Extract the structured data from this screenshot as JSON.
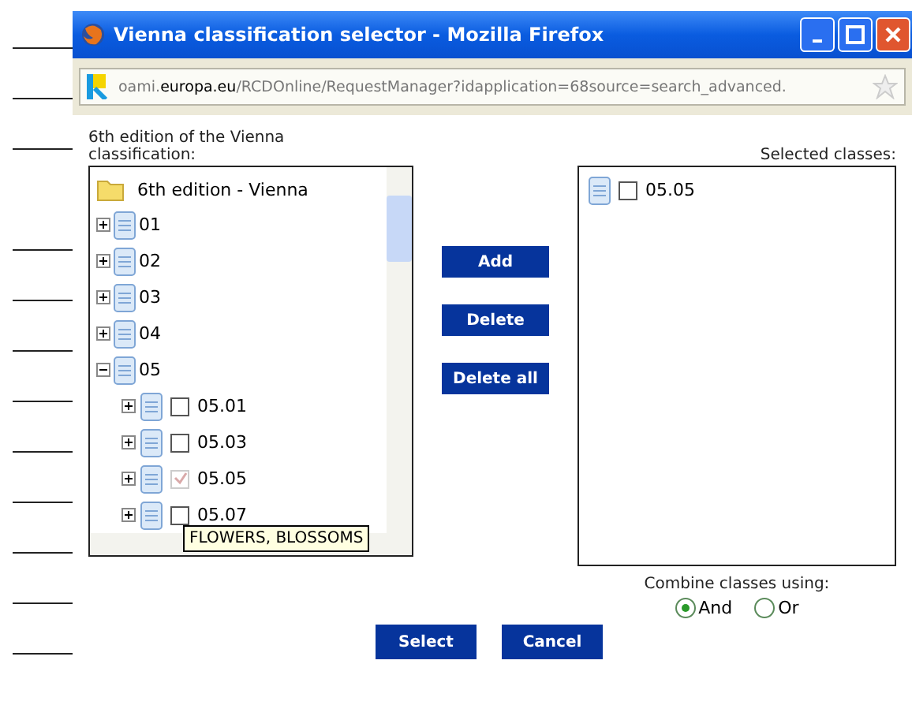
{
  "window": {
    "title": "Vienna classification selector - Mozilla Firefox"
  },
  "address_bar": {
    "url_pre": "oami.",
    "url_domain": "europa.eu",
    "url_post": "/RCDOnline/RequestManager?idapplication=68source=search_advanced."
  },
  "tree_label": "6th edition of the Vienna classification:",
  "tree": {
    "label": "6th edition - Vienna",
    "children": [
      {
        "label": "01",
        "expanded": false
      },
      {
        "label": "02",
        "expanded": false
      },
      {
        "label": "03",
        "expanded": false
      },
      {
        "label": "04",
        "expanded": false
      },
      {
        "label": "05",
        "expanded": true,
        "children": [
          {
            "label": "05.01",
            "expanded": false,
            "checked": false,
            "disabled": false
          },
          {
            "label": "05.03",
            "expanded": false,
            "checked": false,
            "disabled": false
          },
          {
            "label": "05.05",
            "expanded": false,
            "checked": true,
            "disabled": true
          },
          {
            "label": "05.07",
            "expanded": false,
            "checked": false,
            "disabled": false
          }
        ]
      }
    ]
  },
  "tooltip": "FLOWERS, BLOSSOMS",
  "buttons": [
    "Add",
    "Delete",
    "Delete all"
  ],
  "selected_label": "Selected classes:",
  "selected_classes": [
    {
      "label": "05.05",
      "checked": false
    }
  ],
  "combine_label": "Combine classes using:",
  "combine_options": [
    {
      "label": "And",
      "selected": true
    },
    {
      "label": "Or",
      "selected": false
    }
  ],
  "footer_buttons": [
    "Select",
    "Cancel"
  ]
}
